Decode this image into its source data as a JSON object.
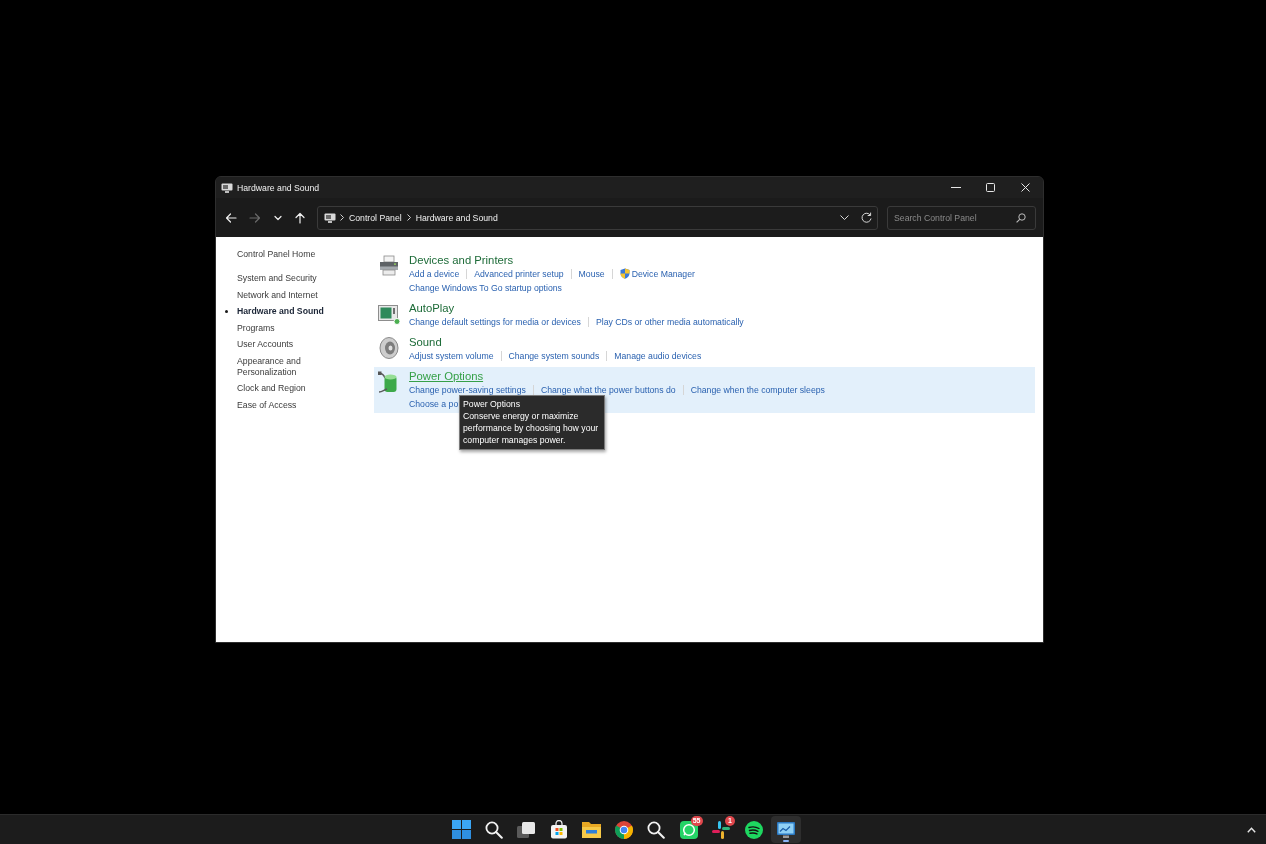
{
  "window": {
    "title": "Hardware and Sound"
  },
  "nav": [
    {
      "kind": "back",
      "disabled": false
    },
    {
      "kind": "forward",
      "disabled": true
    },
    {
      "kind": "recent",
      "disabled": false
    },
    {
      "kind": "up",
      "disabled": false
    }
  ],
  "address_bar": {
    "breadcrumb": [
      "Control Panel",
      "Hardware and Sound"
    ]
  },
  "search": {
    "placeholder": "Search Control Panel"
  },
  "sidebar": {
    "home": "Control Panel Home",
    "items": [
      {
        "label": "System and Security",
        "selected": false
      },
      {
        "label": "Network and Internet",
        "selected": false
      },
      {
        "label": "Hardware and Sound",
        "selected": true
      },
      {
        "label": "Programs",
        "selected": false
      },
      {
        "label": "User Accounts",
        "selected": false
      },
      {
        "label": "Appearance and Personalization",
        "selected": false
      },
      {
        "label": "Clock and Region",
        "selected": false
      },
      {
        "label": "Ease of Access",
        "selected": false
      }
    ]
  },
  "categories": [
    {
      "kind": "printer",
      "title": "Devices and Printers",
      "hovered": false,
      "link_lines": [
        [
          {
            "label": "Add a device",
            "shield": false
          },
          {
            "label": "Advanced printer setup",
            "shield": false
          },
          {
            "label": "Mouse",
            "shield": false
          },
          {
            "label": "Device Manager",
            "shield": true
          }
        ],
        [
          {
            "label": "Change Windows To Go startup options",
            "shield": false
          }
        ]
      ]
    },
    {
      "kind": "autoplay",
      "title": "AutoPlay",
      "hovered": false,
      "link_lines": [
        [
          {
            "label": "Change default settings for media or devices",
            "shield": false
          },
          {
            "label": "Play CDs or other media automatically",
            "shield": false
          }
        ]
      ]
    },
    {
      "kind": "sound",
      "title": "Sound",
      "hovered": false,
      "link_lines": [
        [
          {
            "label": "Adjust system volume",
            "shield": false
          },
          {
            "label": "Change system sounds",
            "shield": false
          },
          {
            "label": "Manage audio devices",
            "shield": false
          }
        ]
      ]
    },
    {
      "kind": "power",
      "title": "Power Options",
      "hovered": true,
      "link_lines": [
        [
          {
            "label": "Change power-saving settings",
            "shield": false
          },
          {
            "label": "Change what the power buttons do",
            "shield": false
          },
          {
            "label": "Change when the computer sleeps",
            "shield": false
          }
        ],
        [
          {
            "label": "Choose a po",
            "shield": false
          }
        ]
      ],
      "tooltip": {
        "title": "Power Options",
        "text": "Conserve energy or maximize performance by choosing how your computer manages power."
      }
    }
  ],
  "taskbar": {
    "items": [
      {
        "kind": "start",
        "active": false
      },
      {
        "kind": "search",
        "active": false
      },
      {
        "kind": "taskview",
        "active": false
      },
      {
        "kind": "store",
        "active": false
      },
      {
        "kind": "files",
        "active": false
      },
      {
        "kind": "browser",
        "active": false
      },
      {
        "kind": "search",
        "active": false
      },
      {
        "kind": "chat",
        "active": false,
        "badge": "55"
      },
      {
        "kind": "pinwheel",
        "active": false,
        "badge": "1"
      },
      {
        "kind": "music",
        "active": false
      },
      {
        "kind": "controlpanel",
        "active": true
      }
    ]
  }
}
